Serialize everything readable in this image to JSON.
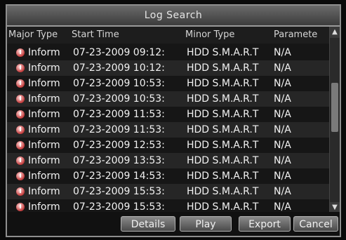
{
  "window": {
    "title": "Log Search"
  },
  "table": {
    "columns": [
      "Major Type",
      "Start Time",
      "Minor Type",
      "Paramete"
    ],
    "rows": [
      {
        "major": "Inform",
        "start": "07-23-2009 09:12:",
        "minor": "HDD S.M.A.R.T",
        "param": "N/A"
      },
      {
        "major": "Inform",
        "start": "07-23-2009 10:12:",
        "minor": "HDD S.M.A.R.T",
        "param": "N/A"
      },
      {
        "major": "Inform",
        "start": "07-23-2009 10:53:",
        "minor": "HDD S.M.A.R.T",
        "param": "N/A"
      },
      {
        "major": "Inform",
        "start": "07-23-2009 10:53:",
        "minor": "HDD S.M.A.R.T",
        "param": "N/A"
      },
      {
        "major": "Inform",
        "start": "07-23-2009 11:53:",
        "minor": "HDD S.M.A.R.T",
        "param": "N/A"
      },
      {
        "major": "Inform",
        "start": "07-23-2009 11:53:",
        "minor": "HDD S.M.A.R.T",
        "param": "N/A"
      },
      {
        "major": "Inform",
        "start": "07-23-2009 12:53:",
        "minor": "HDD S.M.A.R.T",
        "param": "N/A"
      },
      {
        "major": "Inform",
        "start": "07-23-2009 13:53:",
        "minor": "HDD S.M.A.R.T",
        "param": "N/A"
      },
      {
        "major": "Inform",
        "start": "07-23-2009 14:53:",
        "minor": "HDD S.M.A.R.T",
        "param": "N/A"
      },
      {
        "major": "Inform",
        "start": "07-23-2009 15:53:",
        "minor": "HDD S.M.A.R.T",
        "param": "N/A"
      },
      {
        "major": "Inform",
        "start": "07-23-2009 15:53:",
        "minor": "HDD S.M.A.R.T",
        "param": "N/A"
      }
    ]
  },
  "buttons": {
    "details": "Details",
    "play": "Play",
    "export": "Export",
    "cancel": "Cancel"
  },
  "icons": {
    "row_icon": "info-alert-icon",
    "scroll_up": "scroll-up-arrow-icon",
    "scroll_down": "scroll-down-arrow-icon"
  },
  "colors": {
    "row_icon": "#c23a3a",
    "row_text": "#f2f2f2"
  }
}
